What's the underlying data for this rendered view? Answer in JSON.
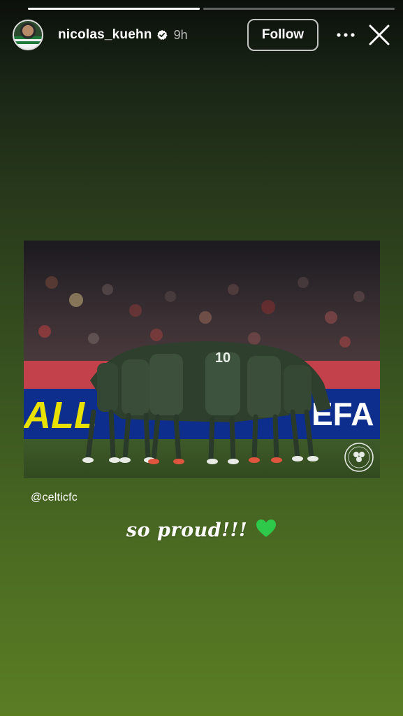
{
  "story": {
    "progress": [
      1.0,
      0.0
    ],
    "username": "nicolas_kuehn",
    "time": "9h",
    "follow_label": "Follow",
    "mention": "@celticfc",
    "caption": "so proud!!!",
    "caption_emoji": "green-heart-icon"
  },
  "photo": {
    "jersey_number": "10",
    "banner_left_text": "ALL",
    "banner_right_text": "EFA"
  },
  "colors": {
    "background_top": "#0b100b",
    "background_bottom": "#5a7d24",
    "heart": "#2ec84a",
    "verified": "#ffffff"
  }
}
